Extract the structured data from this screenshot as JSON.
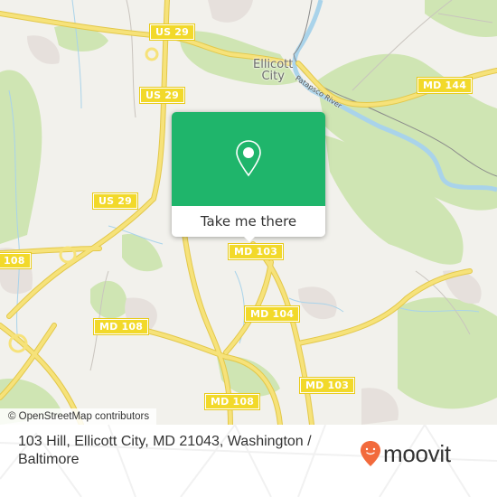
{
  "map": {
    "colors": {
      "background": "#f2f1ec",
      "park": "#cfe5b3",
      "urban": "#e6e0dc",
      "water": "#a9d3ea",
      "road_major": "#f6e27a",
      "road_outline": "#e3c84a",
      "rail": "#8a8a8a",
      "shield_bg": "#f2d92a"
    },
    "place_labels": [
      {
        "name": "ellicott-city-label",
        "text_line1": "Ellicott",
        "text_line2": "City"
      }
    ],
    "river_label": "Patapsco River",
    "road_shields": [
      {
        "id": "us29-top",
        "text": "US 29"
      },
      {
        "id": "us29-mid",
        "text": "US 29"
      },
      {
        "id": "us29-low",
        "text": "US 29"
      },
      {
        "id": "md144",
        "text": "MD 144"
      },
      {
        "id": "md108-left",
        "text": "108"
      },
      {
        "id": "md108-mid",
        "text": "MD 108"
      },
      {
        "id": "md108-low",
        "text": "MD 108"
      },
      {
        "id": "md103-top",
        "text": "MD 103"
      },
      {
        "id": "md104",
        "text": "MD 104"
      },
      {
        "id": "md103-low",
        "text": "MD 103"
      }
    ]
  },
  "popup": {
    "icon": "map-pin-icon",
    "accent": "#1fb56b",
    "button_label": "Take me there"
  },
  "attribution": "© OpenStreetMap contributors",
  "footer": {
    "address": "103 Hill, Ellicott City, MD 21043, Washington / Baltimore",
    "brand": {
      "name": "moovit",
      "icon": "moovit-pin-logo-icon",
      "color": "#f26a3c"
    }
  }
}
